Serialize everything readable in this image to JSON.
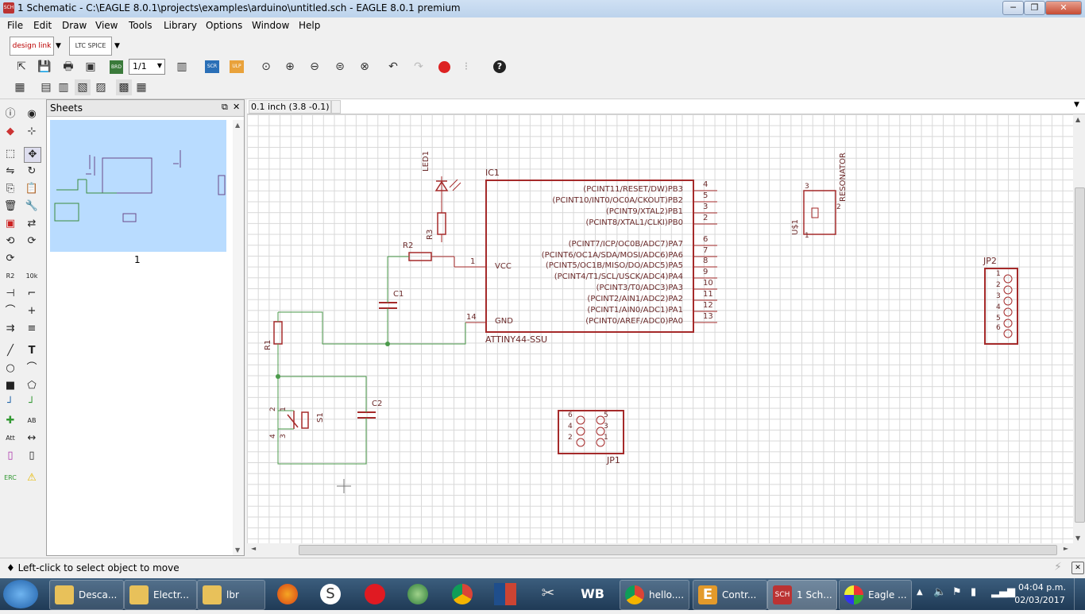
{
  "window": {
    "icon_text": "SCH",
    "title": "1 Schematic - C:\\EAGLE 8.0.1\\projects\\examples\\arduino\\untitled.sch - EAGLE 8.0.1 premium",
    "minimize": "─",
    "maximize": "❐",
    "close": "✕"
  },
  "menu": [
    "File",
    "Edit",
    "Draw",
    "View",
    "Tools",
    "Library",
    "Options",
    "Window",
    "Help"
  ],
  "toolbar1": {
    "designlink_label": "design link",
    "ltspice_label": "LTC SPICE"
  },
  "toolbar2": {
    "sheet_select": "1/1",
    "brd_label": "BRD",
    "scr_label": "SCR",
    "ulp_label": "ULP",
    "help_label": "?"
  },
  "sheets_panel": {
    "title": "Sheets",
    "sheet_number": "1"
  },
  "command_line": {
    "coordinate": "0.1 inch (3.8 -0.1)",
    "value": ""
  },
  "schematic": {
    "ic1": {
      "name": "IC1",
      "value": "ATTINY44-SSU",
      "vcc_label": "VCC",
      "gnd_label": "GND",
      "pin_vcc": "1",
      "pin_gnd": "14",
      "pins_right": [
        {
          "label": "(PCINT11/RESET/DW)PB3",
          "num": "4"
        },
        {
          "label": "(PCINT10/INT0/OC0A/CKOUT)PB2",
          "num": "5"
        },
        {
          "label": "(PCINT9/XTAL2)PB1",
          "num": "3"
        },
        {
          "label": "(PCINT8/XTAL1/CLKI)PB0",
          "num": "2"
        },
        {
          "label": "(PCINT7/ICP/OC0B/ADC7)PA7",
          "num": "6"
        },
        {
          "label": "(PCINT6/OC1A/SDA/MOSI/ADC6)PA6",
          "num": "7"
        },
        {
          "label": "(PCINT5/OC1B/MISO/DO/ADC5)PA5",
          "num": "8"
        },
        {
          "label": "(PCINT4/T1/SCL/USCK/ADC4)PA4",
          "num": "9"
        },
        {
          "label": "(PCINT3/T0/ADC3)PA3",
          "num": "10"
        },
        {
          "label": "(PCINT2/AIN1/ADC2)PA2",
          "num": "11"
        },
        {
          "label": "(PCINT1/AIN0/ADC1)PA1",
          "num": "12"
        },
        {
          "label": "(PCINT0/AREF/ADC0)PA0",
          "num": "13"
        }
      ]
    },
    "led1": "LED1",
    "r3": "R3",
    "r2": "R2",
    "r1": "R1",
    "c1": "C1",
    "c2": "C2",
    "s1": "S1",
    "s1_pins": [
      "2",
      "1",
      "4",
      "3"
    ],
    "u1": "U$1",
    "resonator": "RESONATOR",
    "u1_pins": [
      "3",
      "2",
      "1"
    ],
    "jp1": "JP1",
    "jp1_pins": [
      "6",
      "5",
      "4",
      "3",
      "2",
      "1"
    ],
    "jp2": "JP2",
    "jp2_pins": [
      "1",
      "2",
      "3",
      "4",
      "5",
      "6"
    ]
  },
  "colors": {
    "part": "#a52a2a",
    "wire": "#4a9a4a",
    "grid": "#d8d8d8",
    "thumb": "#b9dcff"
  },
  "status": "♦ Left-click to select object to move",
  "taskbar": {
    "start_icon": "windows-orb",
    "tasks": [
      {
        "label": "Desca...",
        "icon": "folder-icon"
      },
      {
        "label": "Electr...",
        "icon": "folder-icon"
      },
      {
        "label": "lbr",
        "icon": "folder-icon"
      },
      {
        "label": "hello....",
        "icon": "chrome-icon"
      },
      {
        "label": "Contr...",
        "icon": "eagle-icon"
      },
      {
        "label": "1 Sch...",
        "icon": "sch-icon"
      },
      {
        "label": "Eagle ...",
        "icon": "paint-icon"
      }
    ],
    "sch_icon_text": "SCH",
    "e_icon_text": "E",
    "skype_text": "S",
    "wb_text": "WB",
    "time": "04:04 p.m.",
    "date": "02/03/2017"
  }
}
